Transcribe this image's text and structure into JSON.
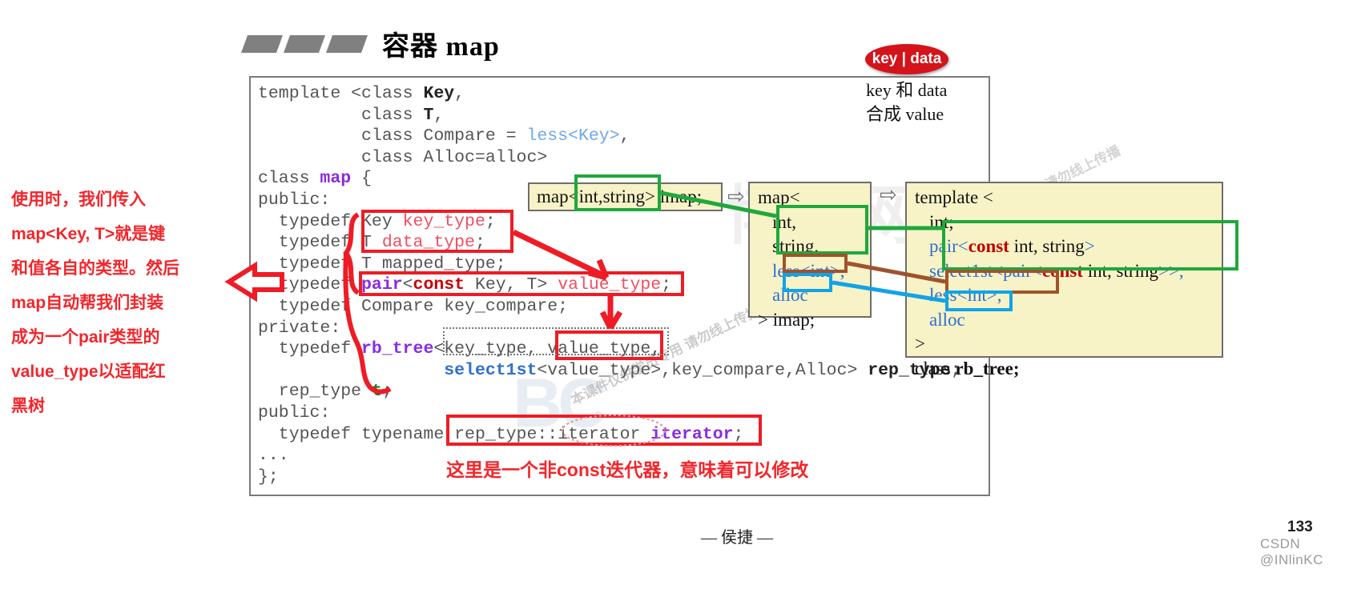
{
  "slide": {
    "title": "容器 map",
    "footer_author": "— 侯捷 —",
    "page_number": "133",
    "watermark_csdn": "CSDN @INlinKC",
    "watermarks": {
      "big_logo": "BC",
      "cn_logo": "博客网",
      "fine_1": "本课件仅供学员专用 请勿线上传播",
      "fine_2": "本课件仅供学员专用 请勿线上传播"
    }
  },
  "badge": {
    "label": "key | data",
    "note_line1": "key 和 data",
    "note_line2": "合成 value"
  },
  "left_note": {
    "lines": [
      "使用时，我们传入",
      "map<Key, T>就是键",
      "和值各自的类型。然后",
      "map自动帮我们封装",
      "成为一个pair类型的",
      "value_type以适配红",
      "黑树"
    ]
  },
  "bottom_note": {
    "text": "这里是一个非const迭代器，意味着可以修改"
  },
  "code": {
    "lines": [
      "template <class Key,",
      "          class T,",
      "          class Compare = less<Key>,",
      "          class Alloc=alloc>",
      "class map {",
      "public:",
      "  typedef Key key_type;",
      "  typedef T data_type;",
      "  typedef T mapped_type;",
      "  typedef pair<const Key, T> value_type;",
      "  typedef Compare key_compare;",
      "private:",
      "  typedef rb_tree<key_type, value_type,",
      "                  select1st<value_type>,key_compare,Alloc> rep_type;",
      "  rep_type t;",
      "public:",
      "  typedef typename rep_type::iterator iterator;",
      "...",
      "};"
    ]
  },
  "boxes": {
    "usage": {
      "text_prefix": "map<",
      "text_highlight": "int,string>",
      "text_suffix": " imap;",
      "full": "map<int,string> imap;"
    },
    "expansion": {
      "lines": [
        "map<",
        "int,",
        "string,",
        "less<int>,",
        "alloc",
        "> imap;"
      ]
    },
    "rbtree": {
      "lines": [
        "template <",
        "int;",
        "pair<const int, string>",
        "select1st<pair<const int, string>>,",
        "less<int>,",
        "alloc",
        ">",
        "class rb_tree;"
      ]
    }
  },
  "colors": {
    "red_annotation": "#f2262b",
    "green_highlight": "#1fa83c",
    "brown_highlight": "#a0522d",
    "cyan_highlight": "#11a3e8",
    "badge_red": "#d4131a",
    "yellow_box": "#f7f3c6"
  },
  "icons": {
    "flow_arrow_1": "⇨",
    "flow_arrow_2": "⇨"
  }
}
